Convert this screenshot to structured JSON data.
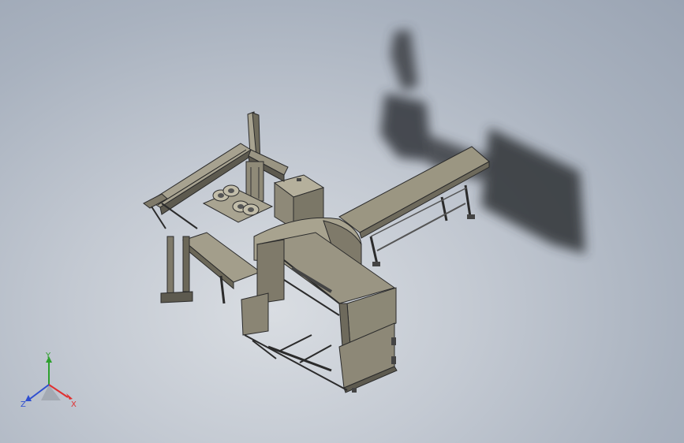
{
  "triad": {
    "x_label": "X",
    "y_label": "Y",
    "z_label": "Z",
    "x_color": "#e03030",
    "y_color": "#2ea02e",
    "z_color": "#2f4fd0"
  },
  "colors": {
    "metal": "#8f8a78",
    "metal_light": "#b4af9c",
    "metal_dark": "#5d5a4f",
    "edge": "#2b2b2b",
    "shadow": "#2e3136"
  }
}
